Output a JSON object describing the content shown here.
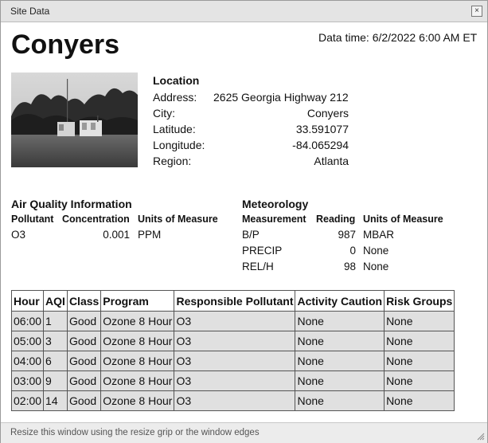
{
  "window": {
    "title": "Site Data",
    "close_glyph": "×"
  },
  "site": {
    "name": "Conyers",
    "data_time": "Data time: 6/2/2022 6:00 AM ET"
  },
  "location": {
    "title": "Location",
    "fields": [
      {
        "label": "Address:",
        "value": "2625 Georgia Highway 212"
      },
      {
        "label": "City:",
        "value": "Conyers"
      },
      {
        "label": "Latitude:",
        "value": "33.591077"
      },
      {
        "label": "Longitude:",
        "value": "-84.065294"
      },
      {
        "label": "Region:",
        "value": "Atlanta"
      }
    ]
  },
  "air_quality": {
    "title": "Air Quality Information",
    "headers": [
      "Pollutant",
      "Concentration",
      "Units of Measure"
    ],
    "rows": [
      {
        "pollutant": "O3",
        "concentration": "0.001",
        "units": "PPM"
      }
    ]
  },
  "meteorology": {
    "title": "Meteorology",
    "headers": [
      "Measurement",
      "Reading",
      "Units of Measure"
    ],
    "rows": [
      {
        "measurement": "B/P",
        "reading": "987",
        "units": "MBAR"
      },
      {
        "measurement": "PRECIP",
        "reading": "0",
        "units": "None"
      },
      {
        "measurement": "REL/H",
        "reading": "98",
        "units": "None"
      }
    ]
  },
  "history": {
    "headers": [
      "Hour",
      "AQI",
      "Class",
      "Program",
      "Responsible Pollutant",
      "Activity Caution",
      "Risk Groups"
    ],
    "rows": [
      [
        "06:00",
        "1",
        "Good",
        "Ozone 8 Hour",
        "O3",
        "None",
        "None"
      ],
      [
        "05:00",
        "3",
        "Good",
        "Ozone 8 Hour",
        "O3",
        "None",
        "None"
      ],
      [
        "04:00",
        "6",
        "Good",
        "Ozone 8 Hour",
        "O3",
        "None",
        "None"
      ],
      [
        "03:00",
        "9",
        "Good",
        "Ozone 8 Hour",
        "O3",
        "None",
        "None"
      ],
      [
        "02:00",
        "14",
        "Good",
        "Ozone 8 Hour",
        "O3",
        "None",
        "None"
      ]
    ]
  },
  "status": {
    "text": "Resize this window using the resize grip or the window edges"
  }
}
